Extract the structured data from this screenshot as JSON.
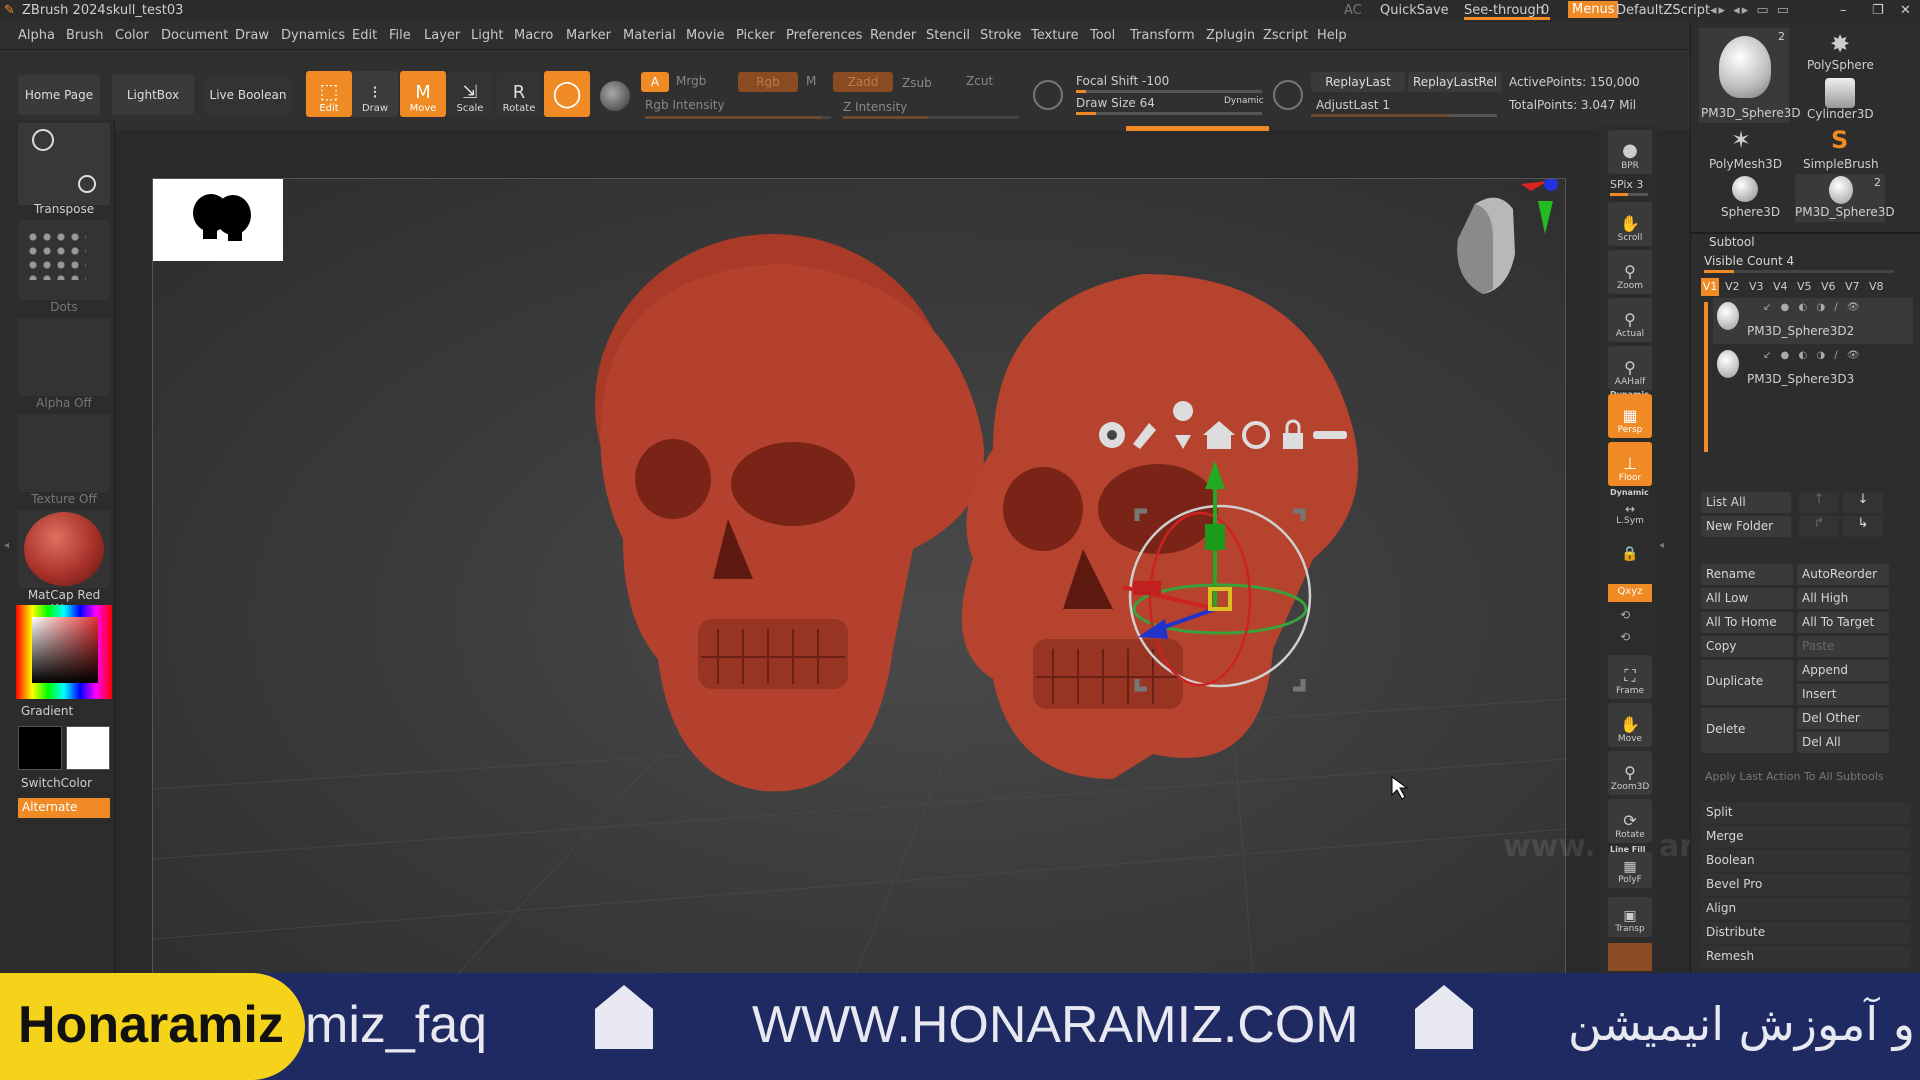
{
  "title": {
    "app": "ZBrush 2024",
    "file": "skull_test03",
    "ac": "AC",
    "quicksave": "QuickSave",
    "seethrough": "See-through",
    "seethrough_value": "0",
    "menus": "Menus",
    "default_zscript": "DefaultZScript"
  },
  "menu": [
    "Alpha",
    "Brush",
    "Color",
    "Document",
    "Draw",
    "Dynamics",
    "Edit",
    "File",
    "Layer",
    "Light",
    "Macro",
    "Marker",
    "Material",
    "Movie",
    "Picker",
    "Preferences",
    "Render",
    "Stencil",
    "Stroke",
    "Texture",
    "Tool",
    "Transform",
    "Zplugin",
    "Zscript",
    "Help"
  ],
  "toolbar": {
    "home": "Home Page",
    "lightbox": "LightBox",
    "live_boolean": "Live Boolean",
    "edit": "Edit",
    "draw": "Draw",
    "move": "Move",
    "scale": "Scale",
    "rotate": "Rotate",
    "a": "A",
    "mrgb": "Mrgb",
    "rgb": "Rgb",
    "m": "M",
    "zadd": "Zadd",
    "zsub": "Zsub",
    "zcut": "Zcut",
    "rgb_intensity": "Rgb Intensity",
    "z_intensity": "Z Intensity",
    "focal_shift": "Focal Shift -100",
    "draw_size": "Draw Size 64",
    "dynamic": "Dynamic",
    "replay_last": "ReplayLast",
    "replay_last_rel": "ReplayLastRel",
    "adjust_last": "AdjustLast 1",
    "active_points": "ActivePoints: 150,000",
    "total_points": "TotalPoints: 3.047 Mil"
  },
  "left": {
    "transpose": "Transpose",
    "dots": "Dots",
    "alpha": "Alpha Off",
    "texture": "Texture Off",
    "matcap": "MatCap Red Wax",
    "gradient": "Gradient",
    "switchcolor": "SwitchColor",
    "alternate": "Alternate"
  },
  "right_shelf": [
    "BPR",
    "SPix 3",
    "Scroll",
    "Zoom",
    "Actual",
    "AAHalf",
    "Persp",
    "Floor",
    "L.Sym",
    "Frame",
    "Move",
    "Zoom3D",
    "Rotate",
    "PolyF",
    "Transp"
  ],
  "right_shelf_extra": {
    "dynamic": "Dynamic",
    "dynamic2": "Dynamic",
    "xyz": "Qxyz",
    "linefill": "Line Fill"
  },
  "tools": [
    {
      "name": "PM3D_Sphere3D",
      "count": "2"
    },
    {
      "name": "PolySphere",
      "count": ""
    },
    {
      "name": "Cylinder3D",
      "count": ""
    },
    {
      "name": "PolyMesh3D",
      "count": ""
    },
    {
      "name": "SimpleBrush",
      "count": ""
    },
    {
      "name": "Sphere3D",
      "count": ""
    },
    {
      "name": "PM3D_Sphere3D",
      "count": "2"
    }
  ],
  "subtool": {
    "title": "Subtool",
    "visible_count": "Visible Count 4",
    "tabs": [
      "V1",
      "V2",
      "V3",
      "V4",
      "V5",
      "V6",
      "V7",
      "V8"
    ],
    "items": [
      "PM3D_Sphere3D2",
      "PM3D_Sphere3D3"
    ],
    "list_all": "List All",
    "new_folder": "New Folder",
    "rename": "Rename",
    "autoreorder": "AutoReorder",
    "all_low": "All Low",
    "all_high": "All High",
    "all_to_home": "All To Home",
    "all_to_target": "All To Target",
    "copy": "Copy",
    "paste": "Paste",
    "duplicate": "Duplicate",
    "append": "Append",
    "insert": "Insert",
    "delete": "Delete",
    "del_other": "Del Other",
    "del_all": "Del All",
    "apply_last": "Apply Last Action To All Subtools",
    "sections": [
      "Split",
      "Merge",
      "Boolean",
      "Bevel Pro",
      "Align",
      "Distribute",
      "Remesh"
    ]
  },
  "watermark": "www.honaramiz.com",
  "banner": {
    "brand": "Honaramiz",
    "handle": "miz_faq",
    "url": "WWW.HONARAMIZ.COM",
    "persian": "ید و آموزش انیمیشن"
  },
  "colors": {
    "accent": "#f08a24",
    "banner_bg": "#1f2a63",
    "brand_yellow": "#f5d31a",
    "skull": "#b0402c"
  }
}
